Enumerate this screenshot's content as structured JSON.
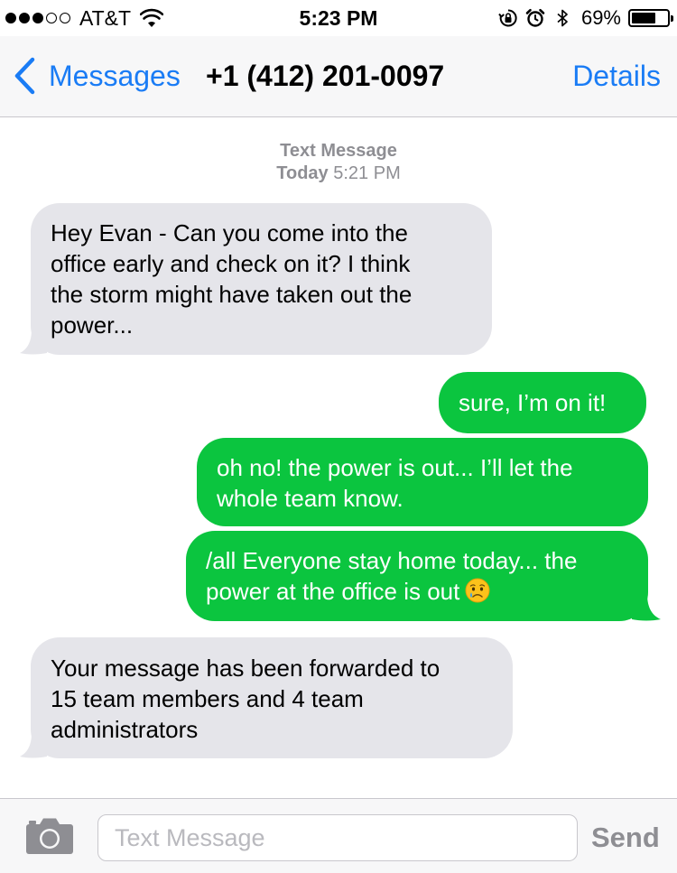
{
  "status_bar": {
    "carrier": "AT&T",
    "time": "5:23 PM",
    "battery_percent": "69%",
    "battery_level": 0.69,
    "signal_bars_filled": 3,
    "signal_bars_total": 5,
    "icons": [
      "wifi-icon",
      "orientation-lock-icon",
      "alarm-icon",
      "bluetooth-icon",
      "battery-icon"
    ]
  },
  "nav": {
    "back_label": "Messages",
    "title": "+1 (412) 201-0097",
    "details_label": "Details"
  },
  "conversation": {
    "timestamp_type": "Text Message",
    "timestamp_day": "Today",
    "timestamp_time": "5:21 PM",
    "messages": [
      {
        "direction": "incoming",
        "text": "Hey Evan - Can you come into the\noffice early and check on it?  I think\nthe storm might have taken out the\npower..."
      },
      {
        "direction": "outgoing",
        "text": "sure, I’m on it!"
      },
      {
        "direction": "outgoing",
        "text": "oh no! the power is out... I’ll let the\nwhole team know."
      },
      {
        "direction": "outgoing",
        "text": "/all Everyone stay home today... the\npower at the office is out",
        "emoji": "crying-face-emoji"
      },
      {
        "direction": "incoming",
        "text": "Your message has been forwarded to\n15 team members and 4 team\nadministrators"
      }
    ]
  },
  "input_bar": {
    "placeholder": "Text Message",
    "value": "",
    "send_label": "Send"
  },
  "colors": {
    "accent": "#1a7cf5",
    "outgoing_bubble": "#0bc53f",
    "incoming_bubble": "#e5e5ea",
    "muted_text": "#8e8e93"
  }
}
